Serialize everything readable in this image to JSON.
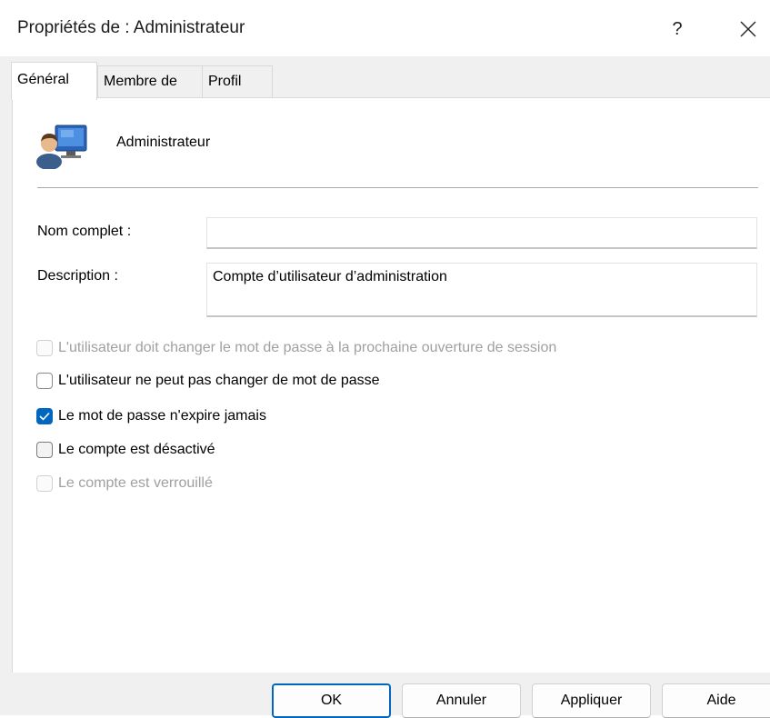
{
  "window": {
    "title": "Propriétés de : Administrateur",
    "help_label": "?",
    "close_icon": "close-icon"
  },
  "tabs": [
    {
      "label": "Général",
      "active": true
    },
    {
      "label": "Membre de",
      "active": false
    },
    {
      "label": "Profil",
      "active": false
    }
  ],
  "general": {
    "user_icon": "user-monitor-icon",
    "username": "Administrateur",
    "fullname_label": "Nom complet :",
    "fullname_value": "",
    "description_label": "Description :",
    "description_value": "Compte d’utilisateur d’administration",
    "options": [
      {
        "label": "L'utilisateur doit changer le mot de passe à la prochaine ouverture de session",
        "checked": false,
        "enabled": false
      },
      {
        "label": "L'utilisateur ne peut pas changer de mot de passe",
        "checked": false,
        "enabled": true
      },
      {
        "label": "Le mot de passe n'expire jamais",
        "checked": true,
        "enabled": true
      },
      {
        "label": "Le compte est désactivé",
        "checked": false,
        "enabled": true
      },
      {
        "label": "Le compte est verrouillé",
        "checked": false,
        "enabled": false
      }
    ]
  },
  "buttons": {
    "ok": "OK",
    "cancel": "Annuler",
    "apply": "Appliquer",
    "help": "Aide"
  },
  "colors": {
    "accent": "#0067c0",
    "disabled_text": "#a0a0a0"
  }
}
